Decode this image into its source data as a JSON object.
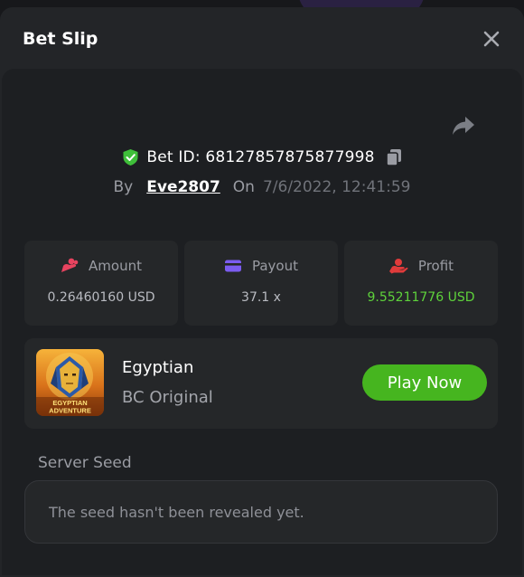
{
  "header": {
    "title": "Bet Slip"
  },
  "bet": {
    "id_text": "Bet ID: 68127857875877998",
    "by_label": "By",
    "username": "Eve2807",
    "on_label": "On",
    "datetime": "7/6/2022, 12:41:59"
  },
  "stats": [
    {
      "label": "Amount",
      "value": "0.26460160 USD",
      "icon": "coins-icon"
    },
    {
      "label": "Payout",
      "value": "37.1 x",
      "icon": "card-icon"
    },
    {
      "label": "Profit",
      "value": "9.55211776 USD",
      "icon": "hand-coin-icon"
    }
  ],
  "game": {
    "name": "Egyptian",
    "provider": "BC Original",
    "thumb_text_line1": "EGYPTIAN",
    "thumb_text_line2": "ADVENTURE",
    "play_label": "Play Now"
  },
  "seed": {
    "label": "Server Seed",
    "text": "The seed hasn't been revealed yet."
  },
  "colors": {
    "accent_green": "#46b51f",
    "profit_green": "#5ed23b",
    "shield_green": "#3fbf3a",
    "amount_icon": "#e8435f",
    "payout_icon": "#7b5cf0",
    "profit_icon": "#e03b3b"
  }
}
